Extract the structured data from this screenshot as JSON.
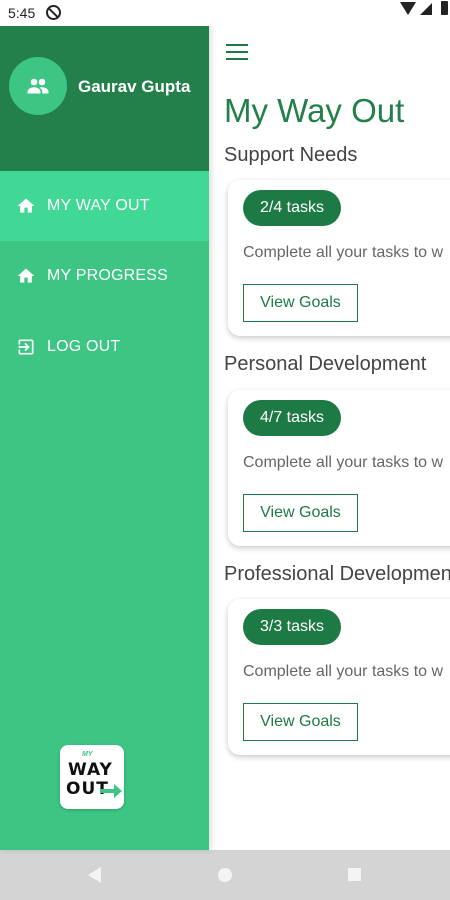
{
  "status_bar": {
    "time": "5:45"
  },
  "header": {
    "title": "My Way Out"
  },
  "drawer": {
    "user_name": "Gaurav Gupta",
    "items": [
      {
        "label": "MY WAY OUT",
        "icon": "home-icon",
        "active": true
      },
      {
        "label": "MY PROGRESS",
        "icon": "home-icon",
        "active": false
      },
      {
        "label": "LOG OUT",
        "icon": "logout-icon",
        "active": false
      }
    ],
    "logo": {
      "small": "MY",
      "line1": "WAY",
      "line2": "OUT"
    }
  },
  "sections": [
    {
      "title": "Support Needs",
      "badge": "2/4 tasks",
      "text": "Complete all your tasks to w",
      "button": "View Goals"
    },
    {
      "title": "Personal Development",
      "badge": "4/7 tasks",
      "text": "Complete all your tasks to w",
      "button": "View Goals"
    },
    {
      "title": "Professional Developmen",
      "badge": "3/3 tasks",
      "text": "Complete all your tasks to w",
      "button": "View Goals"
    }
  ],
  "colors": {
    "primary_dark": "#23804a",
    "drawer_green": "#3dc583",
    "active_item": "#41d896",
    "badge_green": "#1e7a45"
  }
}
